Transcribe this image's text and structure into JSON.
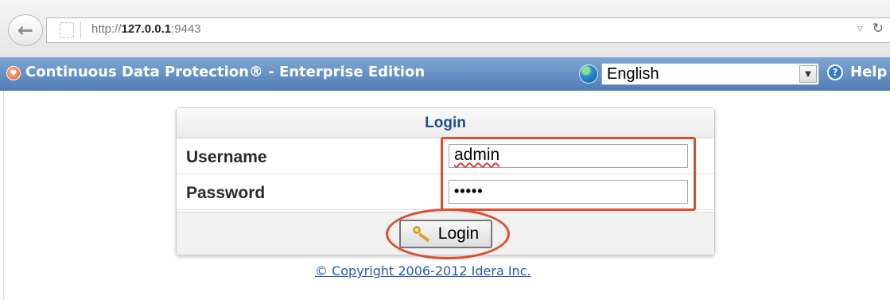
{
  "browser": {
    "url_prefix": "http://",
    "url_host": "127.0.0.1",
    "url_port": ":9443",
    "url_dropdown_icon": "dropdown-icon",
    "reload_icon": "reload-icon"
  },
  "header": {
    "title": "Continuous Data Protection® - Enterprise Edition",
    "logo_icon": "shield-icon",
    "language": "English",
    "language_icon": "globe-icon",
    "help_icon": "help-icon",
    "help_label": "Help"
  },
  "login": {
    "title": "Login",
    "username_label": "Username",
    "username_value": "admin",
    "password_label": "Password",
    "password_value": "•••••",
    "button_label": "Login",
    "button_icon": "key-icon"
  },
  "footer": {
    "copyright": "© Copyright 2006-2012 Idera Inc."
  },
  "colors": {
    "header_gradient_top": "#7fa7d3",
    "header_gradient_bottom": "#4f7db5",
    "highlight_red": "#d94f2f",
    "link_blue": "#2458b3",
    "panel_title_blue": "#1e4f8f"
  }
}
